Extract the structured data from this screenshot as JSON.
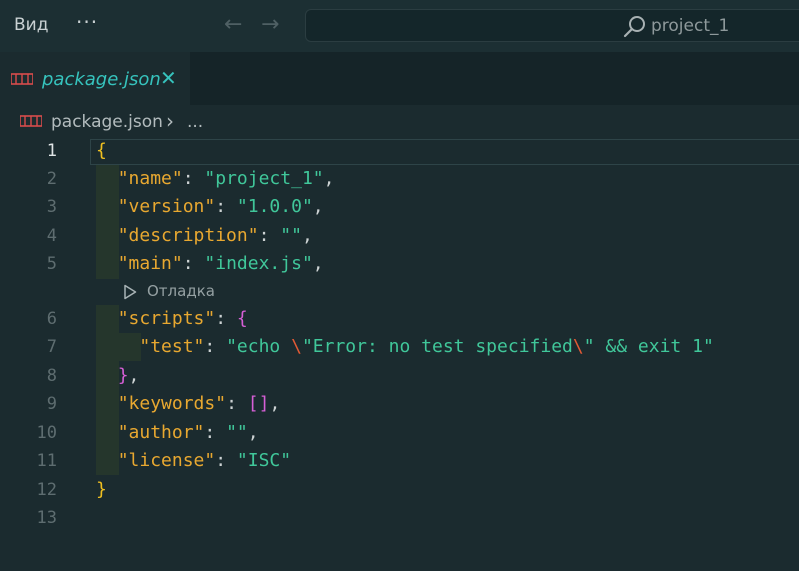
{
  "titlebar": {
    "menu_view": "Вид",
    "menu_more": "···",
    "back_icon": "arrow-left-icon",
    "forward_icon": "arrow-right-icon",
    "search_text": "project_1"
  },
  "tabs": [
    {
      "label": "package.json",
      "icon": "json-file-icon",
      "active": true
    }
  ],
  "breadcrumb": {
    "file": "package.json",
    "separator": "›",
    "more": "..."
  },
  "editor": {
    "codelens_label": "Отладка",
    "line_numbers": [
      "1",
      "2",
      "3",
      "4",
      "5",
      "6",
      "7",
      "8",
      "9",
      "10",
      "11",
      "12",
      "13"
    ],
    "active_line": "1",
    "lines": {
      "l1": {
        "open": "{"
      },
      "l2": {
        "key": "\"name\"",
        "colon": ": ",
        "value": "\"project_1\"",
        "comma": ","
      },
      "l3": {
        "key": "\"version\"",
        "colon": ": ",
        "value": "\"1.0.0\"",
        "comma": ","
      },
      "l4": {
        "key": "\"description\"",
        "colon": ": ",
        "value": "\"\"",
        "comma": ","
      },
      "l5": {
        "key": "\"main\"",
        "colon": ": ",
        "value": "\"index.js\"",
        "comma": ","
      },
      "l6": {
        "key": "\"scripts\"",
        "colon": ": ",
        "open": "{"
      },
      "l7": {
        "key": "\"test\"",
        "colon": ": ",
        "v1": "\"echo ",
        "e1": "\\",
        "v2": "\"Error: no test specified",
        "e2": "\\",
        "v3": "\" && exit 1\""
      },
      "l8": {
        "close": "}",
        "comma": ","
      },
      "l9": {
        "key": "\"keywords\"",
        "colon": ": ",
        "array": "[]",
        "comma": ","
      },
      "l10": {
        "key": "\"author\"",
        "colon": ": ",
        "value": "\"\"",
        "comma": ","
      },
      "l11": {
        "key": "\"license\"",
        "colon": ": ",
        "value": "\"ISC\""
      },
      "l12": {
        "close": "}"
      }
    }
  },
  "colors": {
    "background": "#1b2b2f",
    "accent_tab": "#36c3bd",
    "json_key": "#e8a830",
    "json_string": "#40c79a",
    "json_escape": "#e25a35",
    "bracket_level1": "#f0c020",
    "bracket_level2": "#d65fd6"
  }
}
